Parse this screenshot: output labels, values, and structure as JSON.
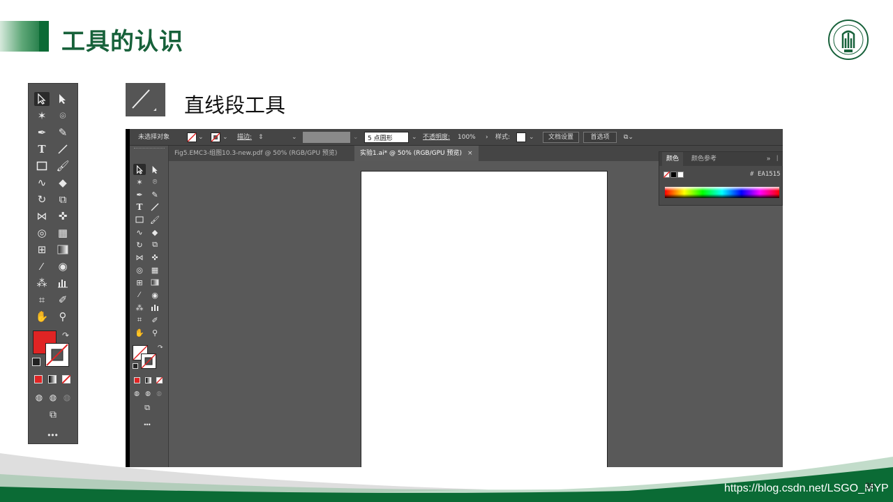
{
  "slide": {
    "title": "工具的认识",
    "tool_heading": "直线段工具",
    "page_number": "35",
    "watermark": "https://blog.csdn.net/LSGO_MYP"
  },
  "colors": {
    "brand_green": "#17613a",
    "toolbar_bg": "#535353",
    "fill_red": "#e02424"
  },
  "app": {
    "control_bar": {
      "selection_label": "未选择对象",
      "stroke_label": "描边:",
      "brush_value": "5 点圆形",
      "opacity_label": "不透明度:",
      "opacity_value": "100%",
      "style_label": "样式:",
      "doc_setup_button": "文档设置",
      "prefs_button": "首选项"
    },
    "tabs": [
      {
        "label": "Fig5.EMC3-组图10.3-new.pdf @ 50% (RGB/GPU 预览)",
        "active": false
      },
      {
        "label": "实验1.ai* @ 50% (RGB/GPU 预览)",
        "active": true,
        "close": "×"
      }
    ],
    "color_panel": {
      "tabs": [
        "颜色",
        "颜色参考"
      ],
      "hex_prefix": "#",
      "hex_value": "EA1515"
    }
  }
}
